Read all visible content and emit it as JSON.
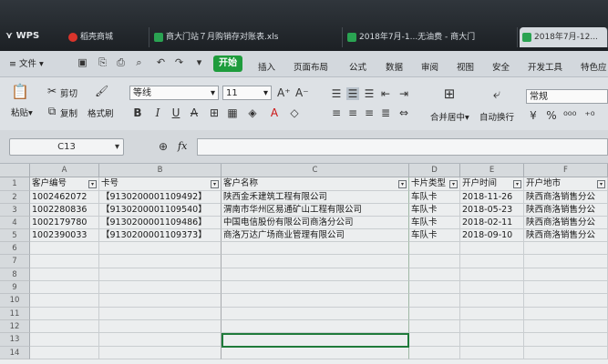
{
  "titlebar": {
    "app": "WPS",
    "tabs": [
      {
        "label": "稻壳商城",
        "icon_color": "#d9342b"
      },
      {
        "label": "商大门站７月购销存对账表.xls",
        "icon_color": "#2aa352"
      },
      {
        "label": "2018年7月-1...无油费 - 商大门",
        "icon_color": "#2aa352"
      },
      {
        "label": "2018年7月-12...",
        "icon_color": "#2aa352"
      }
    ]
  },
  "menubar": {
    "file": "文件",
    "start": "开始",
    "items": [
      "插入",
      "页面布局",
      "公式",
      "数据",
      "审阅",
      "视图",
      "安全",
      "开发工具",
      "特色应"
    ]
  },
  "ribbon": {
    "paste": "粘贴",
    "cut": "剪切",
    "copy": "复制",
    "format_painter": "格式刷",
    "font_name": "等线",
    "font_size": "11",
    "merge": "合并居中",
    "wrap": "自动换行",
    "number_format": "常规"
  },
  "formula_bar": {
    "name_box": "C13",
    "fx": "fx"
  },
  "sheet": {
    "columns": [
      "A",
      "B",
      "C",
      "D",
      "E",
      "F"
    ],
    "rows": [
      "1",
      "2",
      "3",
      "4",
      "5",
      "6",
      "7",
      "8",
      "9",
      "10",
      "11",
      "12",
      "13",
      "14"
    ],
    "headers": [
      "客户编号",
      "卡号",
      "客户名称",
      "卡片类型",
      "开户时间",
      "开户地市"
    ],
    "data": [
      [
        "1002462072",
        "【9130200001109492】",
        "陕西金禾建筑工程有限公司",
        "车队卡",
        "2018-11-26",
        "陕西商洛销售分公"
      ],
      [
        "1002280836",
        "【9130200001109540】",
        "渭南市华州区易通矿山工程有限公司",
        "车队卡",
        "2018-05-23",
        "陕西商洛销售分公"
      ],
      [
        "1002179780",
        "【9130200001109486】",
        "中国电信股份有限公司商洛分公司",
        "车队卡",
        "2018-02-11",
        "陕西商洛销售分公"
      ],
      [
        "1002390033",
        "【9130200001109373】",
        "商洛万达广场商业管理有限公司",
        "车队卡",
        "2018-09-10",
        "陕西商洛销售分公"
      ]
    ]
  }
}
